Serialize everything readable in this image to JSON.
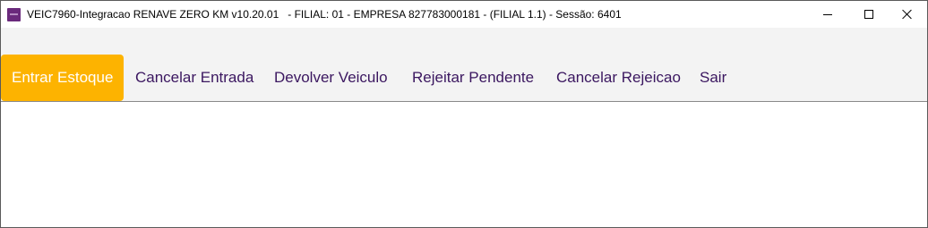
{
  "window": {
    "title": "VEIC7960-Integracao RENAVE ZERO KM v10.20.01   - FILIAL: 01 - EMPRESA 827783000181 - (FILIAL 1.1) - Sessão: 6401",
    "controls": {
      "minimize": "minimize-icon",
      "maximize": "maximize-icon",
      "close": "close-icon"
    }
  },
  "menu": {
    "items": [
      {
        "label": "Entrar Estoque",
        "active": true
      },
      {
        "label": "Cancelar Entrada",
        "active": false
      },
      {
        "label": "Devolver Veiculo",
        "active": false
      },
      {
        "label": "Rejeitar Pendente",
        "active": false
      },
      {
        "label": "Cancelar Rejeicao",
        "active": false
      },
      {
        "label": "Sair",
        "active": false
      }
    ]
  },
  "colors": {
    "active_tab_bg": "#fdb300",
    "menu_text": "#3b1760",
    "menubar_bg": "#f3f3f3",
    "app_icon": "#6a2a7c"
  }
}
